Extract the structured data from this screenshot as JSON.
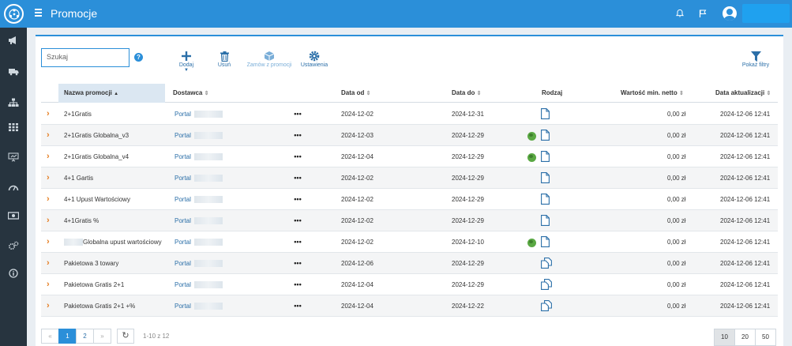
{
  "header": {
    "title": "Promocje",
    "icons": [
      "app-logo-icon",
      "menu-icon",
      "bell-icon",
      "flag-icon",
      "user-avatar-icon"
    ]
  },
  "sidebar": {
    "icons": [
      "megaphone-icon",
      "truck-icon",
      "hierarchy-icon",
      "grid-icon",
      "presentation-icon",
      "gauge-icon",
      "money-icon",
      "gears-icon",
      "info-icon"
    ]
  },
  "toolbar": {
    "search_placeholder": "Szukaj",
    "help": "?",
    "add": "Dodaj",
    "delete": "Usuń",
    "order_from_promotion": "Zamów z promocji",
    "settings": "Ustawienia",
    "show_filters": "Pokaż filtry"
  },
  "table": {
    "columns": {
      "name": "Nazwa promocji",
      "supplier": "Dostawca",
      "date_from": "Data od",
      "date_to": "Data do",
      "kind": "Rodzaj",
      "min_value": "Wartość min. netto",
      "updated": "Data aktualizacji"
    },
    "rows": [
      {
        "name": "2+1Gratis",
        "supplier": "Portal",
        "date_from": "2024-12-02",
        "date_to": "2024-12-31",
        "globe": false,
        "kind_icon": "document-icon",
        "min_value": "0,00 zł",
        "updated": "2024-12-06 12:41"
      },
      {
        "name": "2+1Gratis Globalna_v3",
        "supplier": "Portal",
        "date_from": "2024-12-03",
        "date_to": "2024-12-29",
        "globe": true,
        "kind_icon": "document-icon",
        "min_value": "0,00 zł",
        "updated": "2024-12-06 12:41"
      },
      {
        "name": "2+1Gratis Globalna_v4",
        "supplier": "Portal",
        "date_from": "2024-12-04",
        "date_to": "2024-12-29",
        "globe": true,
        "kind_icon": "document-icon",
        "min_value": "0,00 zł",
        "updated": "2024-12-06 12:41"
      },
      {
        "name": "4+1 Gartis",
        "supplier": "Portal",
        "date_from": "2024-12-02",
        "date_to": "2024-12-29",
        "globe": false,
        "kind_icon": "document-icon",
        "min_value": "0,00 zł",
        "updated": "2024-12-06 12:41"
      },
      {
        "name": "4+1 Upust Wartościowy",
        "supplier": "Portal",
        "date_from": "2024-12-02",
        "date_to": "2024-12-29",
        "globe": false,
        "kind_icon": "document-icon",
        "min_value": "0,00 zł",
        "updated": "2024-12-06 12:41"
      },
      {
        "name": "4+1Gratis %",
        "supplier": "Portal",
        "date_from": "2024-12-02",
        "date_to": "2024-12-29",
        "globe": false,
        "kind_icon": "document-icon",
        "min_value": "0,00 zł",
        "updated": "2024-12-06 12:41"
      },
      {
        "name": "Globalna upust wartościowy",
        "supplier": "Portal",
        "date_from": "2024-12-02",
        "date_to": "2024-12-10",
        "globe": true,
        "kind_icon": "document-icon",
        "min_value": "0,00 zł",
        "updated": "2024-12-06 12:41",
        "blurred_prefix": true
      },
      {
        "name": "Pakietowa 3 towary",
        "supplier": "Portal",
        "date_from": "2024-12-06",
        "date_to": "2024-12-29",
        "globe": false,
        "kind_icon": "package-documents-icon",
        "min_value": "0,00 zł",
        "updated": "2024-12-06 12:41"
      },
      {
        "name": "Pakietowa Gratis 2+1",
        "supplier": "Portal",
        "date_from": "2024-12-04",
        "date_to": "2024-12-29",
        "globe": false,
        "kind_icon": "package-documents-icon",
        "min_value": "0,00 zł",
        "updated": "2024-12-06 12:41"
      },
      {
        "name": "Pakietowa Gratis 2+1 +%",
        "supplier": "Portal",
        "date_from": "2024-12-04",
        "date_to": "2024-12-22",
        "globe": false,
        "kind_icon": "package-documents-icon",
        "min_value": "0,00 zł",
        "updated": "2024-12-06 12:41"
      }
    ]
  },
  "pagination": {
    "first": "«",
    "pages": [
      "1",
      "2"
    ],
    "next": "»",
    "refresh": "↻",
    "summary": "1-10 z 12",
    "page_sizes": [
      "10",
      "20",
      "50"
    ]
  }
}
